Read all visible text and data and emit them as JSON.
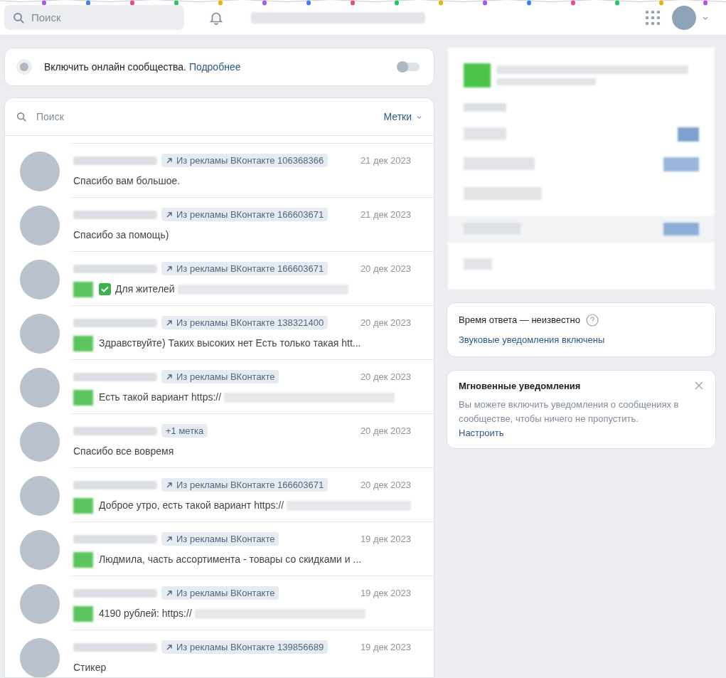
{
  "header": {
    "search_placeholder": "Поиск"
  },
  "online_card": {
    "text": "Включить онлайн сообщества.",
    "link": "Подробнее",
    "on": false
  },
  "dialogs": {
    "search_placeholder": "Поиск",
    "filter": "Метки",
    "items": [
      {
        "tag": "Из рекламы ВКонтакте 106368366",
        "arrow": true,
        "date": "21 дек 2023",
        "message": "Спасибо вам большое.",
        "attachment": false,
        "check": false,
        "hidden_tail": false
      },
      {
        "tag": "Из рекламы ВКонтакте 166603671",
        "arrow": true,
        "date": "21 дек 2023",
        "message": "Спасибо за помощь)",
        "attachment": false,
        "check": false,
        "hidden_tail": false
      },
      {
        "tag": "Из рекламы ВКонтакте 166603671",
        "arrow": true,
        "date": "20 дек 2023",
        "message": "Для жителей",
        "attachment": true,
        "check": true,
        "hidden_tail": true
      },
      {
        "tag": "Из рекламы ВКонтакте 138321400",
        "arrow": true,
        "date": "20 дек 2023",
        "message": "Здравствуйте) Таких высоких нет Есть только такая htt...",
        "attachment": true,
        "check": false,
        "hidden_tail": false
      },
      {
        "tag": "Из рекламы ВКонтакте",
        "arrow": true,
        "date": "20 дек 2023",
        "message": "Есть такой вариант https://",
        "attachment": true,
        "check": false,
        "hidden_tail": true
      },
      {
        "tag": "+1 метка",
        "arrow": false,
        "date": "20 дек 2023",
        "message": "Спасибо все вовремя",
        "attachment": false,
        "check": false,
        "hidden_tail": false
      },
      {
        "tag": "Из рекламы ВКонтакте 166603671",
        "arrow": true,
        "date": "20 дек 2023",
        "message": "Доброе утро, есть такой вариант https://",
        "attachment": true,
        "check": false,
        "hidden_tail": true
      },
      {
        "tag": "Из рекламы ВКонтакте",
        "arrow": true,
        "date": "19 дек 2023",
        "message": "Людмила, часть ассортимента - товары со скидками и ...",
        "attachment": true,
        "check": false,
        "hidden_tail": false
      },
      {
        "tag": "Из рекламы ВКонтакте",
        "arrow": true,
        "date": "19 дек 2023",
        "message": "4190 рублей: https://",
        "attachment": true,
        "check": false,
        "hidden_tail": true
      },
      {
        "tag": "Из рекламы ВКонтакте 139856689",
        "arrow": true,
        "date": "19 дек 2023",
        "message": "Стикер",
        "attachment": false,
        "check": false,
        "hidden_tail": false
      }
    ]
  },
  "response_card": {
    "text": "Время ответа — неизвестно",
    "link": "Звуковые уведомления включены"
  },
  "notify_card": {
    "title": "Мгновенные уведомления",
    "text": "Вы можете включить уведомления о сообщениях в сообществе, чтобы ничего не пропустить.",
    "link": "Настроить"
  }
}
